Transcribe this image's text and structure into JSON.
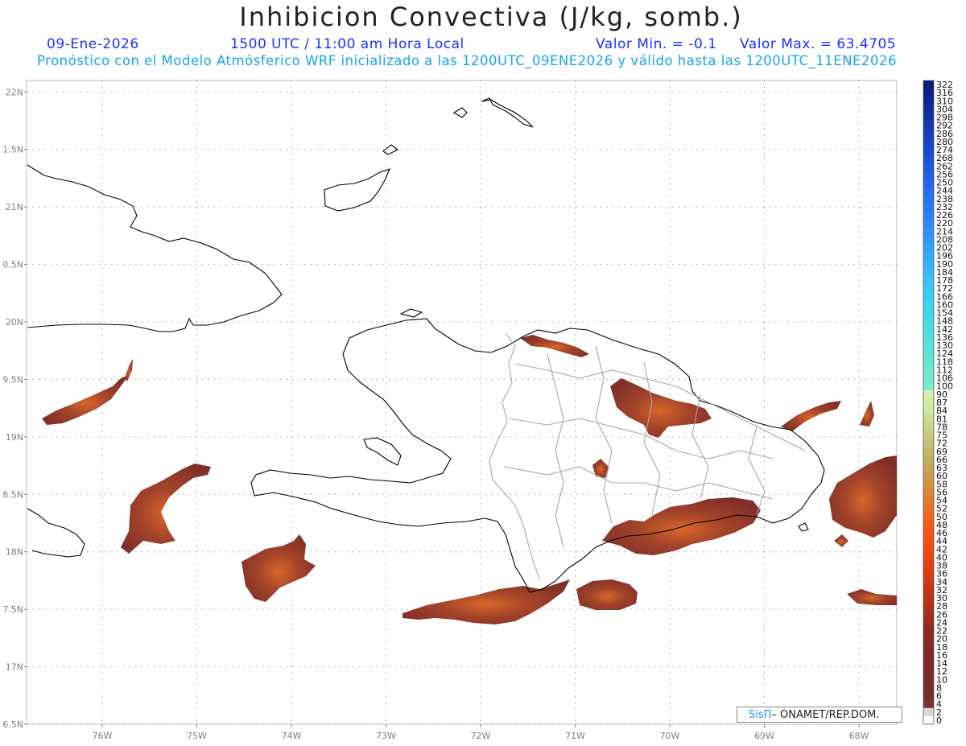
{
  "header": {
    "title": "Inhibicion Convectiva (J/kg, somb.)",
    "date": "09-Ene-2026",
    "time": "1500 UTC / 11:00 am Hora Local",
    "valmin": "Valor Min. = -0.1",
    "valmax": "Valor Max. = 63.4705",
    "subtitle": "Pronóstico con el Modelo Atmósferico WRF inicializado a las 1200UTC_09ENE2026 y válido hasta las  1200UTC_11ENE2026"
  },
  "credit": {
    "brand": "SisΠ",
    "text": "– ONAMET/REP.DOM."
  },
  "chart_data": {
    "type": "heatmap",
    "title": "Inhibicion Convectiva (J/kg, somb.)",
    "x_ticks": [
      "76W",
      "75W",
      "74W",
      "73W",
      "72W",
      "71W",
      "70W",
      "69W",
      "68W"
    ],
    "x_values": [
      -76,
      -75,
      -74,
      -73,
      -72,
      -71,
      -70,
      -69,
      -68
    ],
    "y_ticks": [
      "22N",
      "1.5N",
      "21N",
      "0.5N",
      "20N",
      "9.5N",
      "19N",
      "8.5N",
      "18N",
      "7.5N",
      "17N",
      "6.5N"
    ],
    "y_values": [
      22,
      21.5,
      21,
      20.5,
      20,
      19.5,
      19,
      18.5,
      18,
      17.5,
      17,
      16.5
    ],
    "xlim": [
      -76.8,
      -67.6
    ],
    "ylim": [
      16.5,
      22.1
    ],
    "grid": true,
    "colorbar_levels": [
      "322",
      "316",
      "310",
      "304",
      "298",
      "292",
      "286",
      "280",
      "274",
      "268",
      "262",
      "256",
      "250",
      "244",
      "238",
      "232",
      "226",
      "220",
      "214",
      "208",
      "202",
      "196",
      "190",
      "184",
      "178",
      "172",
      "166",
      "160",
      "154",
      "148",
      "142",
      "136",
      "130",
      "124",
      "118",
      "112",
      "106",
      "100",
      "90",
      "87",
      "84",
      "81",
      "78",
      "75",
      "72",
      "69",
      "66",
      "63",
      "60",
      "58",
      "56",
      "54",
      "52",
      "50",
      "48",
      "46",
      "44",
      "42",
      "40",
      "38",
      "36",
      "34",
      "32",
      "30",
      "28",
      "26",
      "24",
      "22",
      "20",
      "18",
      "16",
      "14",
      "12",
      "10",
      "8",
      "6",
      "4",
      "2",
      "0"
    ],
    "colorbar_colors": [
      "#0a1a7a",
      "#0c1f86",
      "#0e2591",
      "#102b9c",
      "#1231a7",
      "#1437b1",
      "#163dbb",
      "#1843c5",
      "#1a49cf",
      "#1c50d8",
      "#1e57e0",
      "#205ee6",
      "#2265ec",
      "#246cf0",
      "#2673f3",
      "#287af6",
      "#2a82f8",
      "#2c8afa",
      "#2e92fb",
      "#309afc",
      "#32a2fc",
      "#34aafc",
      "#36b2fb",
      "#38bafa",
      "#3ac1f8",
      "#3cc7f5",
      "#3ecdf2",
      "#40d2ee",
      "#43d6ea",
      "#47dae6",
      "#4cdde2",
      "#52e0de",
      "#58e2da",
      "#5ee4d6",
      "#65e6d2",
      "#6ce8ce",
      "#73eac9",
      "#7aecc5",
      "#d9f0b0",
      "#d4eba6",
      "#cfe69c",
      "#cade92",
      "#c6d588",
      "#c3cc7e",
      "#c0c274",
      "#c1b86a",
      "#c4ae60",
      "#c9a456",
      "#cf9a4c",
      "#d69042",
      "#dd8638",
      "#e37c2e",
      "#e97224",
      "#ee681c",
      "#f25e16",
      "#f45612",
      "#f54f10",
      "#f2490f",
      "#ec4410",
      "#e44011",
      "#da3c13",
      "#cf3815",
      "#c43517",
      "#b93219",
      "#ae301b",
      "#a42e1d",
      "#9b2c1f",
      "#932a21",
      "#8c2923",
      "#862925",
      "#812927",
      "#7d2a29",
      "#7a2b2b",
      "#782c2d",
      "#772d2f",
      "#762e31",
      "#7a3335",
      "#d8d8d8",
      "#ffffff"
    ]
  }
}
